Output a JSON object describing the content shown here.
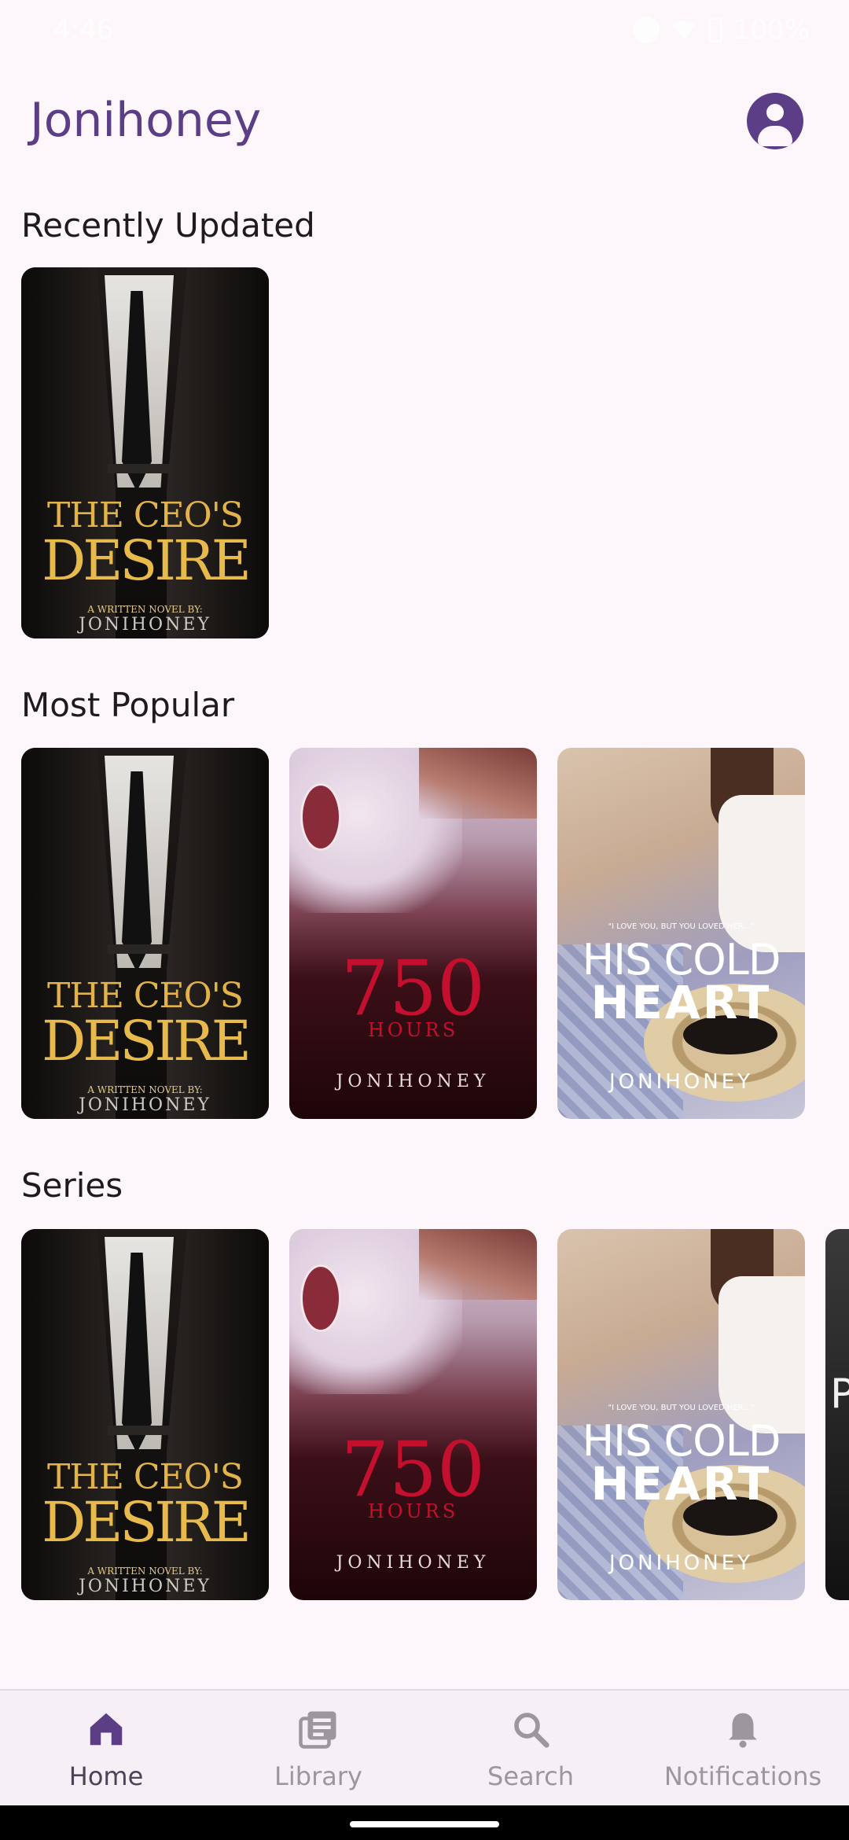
{
  "status_bar": {
    "time": "4:46",
    "battery": "100%"
  },
  "header": {
    "title": "Jonihoney"
  },
  "sections": [
    {
      "title": "Recently Updated"
    },
    {
      "title": "Most Popular"
    },
    {
      "title": "Series"
    }
  ],
  "covers": {
    "ceo": {
      "line1": "THE CEO'S",
      "line2": "DESIRE",
      "sub": "A WRITTEN NOVEL BY:",
      "author": "JONIHONEY"
    },
    "hours": {
      "number": "750",
      "word": "HOURS",
      "author": "JONIHONEY"
    },
    "cold": {
      "quote": "\"I LOVE YOU, BUT YOU LOVED HER...\"",
      "line1": "HIS COLD",
      "line2": "HEART",
      "author": "JONIHONEY"
    },
    "peek": {
      "letter": "P"
    }
  },
  "nav": [
    {
      "label": "Home",
      "icon": "home-icon",
      "active": true
    },
    {
      "label": "Library",
      "icon": "library-icon",
      "active": false
    },
    {
      "label": "Search",
      "icon": "search-icon",
      "active": false
    },
    {
      "label": "Notifications",
      "icon": "bell-icon",
      "active": false
    }
  ],
  "colors": {
    "accent": "#5B3E86",
    "background": "#FDF7FB",
    "nav_background": "#F6EFF6"
  }
}
